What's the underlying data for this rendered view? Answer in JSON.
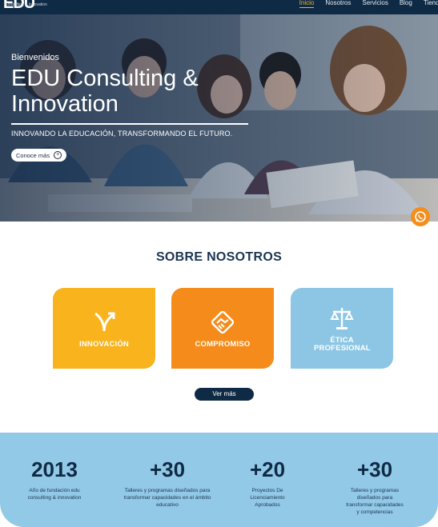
{
  "nav": {
    "logo_mark": "EDU",
    "logo_sub": "Consulting & Innovation",
    "links": [
      "Inicio",
      "Nosotros",
      "Servicios",
      "Blog",
      "Tienda"
    ]
  },
  "hero": {
    "welcome": "Bienvenidos",
    "title": "EDU Consulting & Innovation",
    "tagline": "INNOVANDO LA EDUCACIÓN, TRANSFORMANDO EL FUTURO.",
    "cta_label": "Conoce más"
  },
  "about": {
    "title": "SOBRE NOSOTROS",
    "cards": [
      {
        "label": "INNOVACIÓN",
        "icon": "merge-arrow-icon",
        "color": "#f8b31d"
      },
      {
        "label": "COMPROMISO",
        "icon": "handshake-icon",
        "color": "#f58b1a"
      },
      {
        "label": "ÉTICA PROFESIONAL",
        "icon": "scales-icon",
        "color": "#8cc6e4"
      }
    ],
    "more_label": "Ver más"
  },
  "stats": [
    {
      "value": "2013",
      "desc": "Año de fundación edu consulting & innovation"
    },
    {
      "value": "+30",
      "desc": "Talleres y programas diseñados para transformar capacidades en el ámbito educativo"
    },
    {
      "value": "+20",
      "desc": "Proyectos De Licenciamiento Aprobados"
    },
    {
      "value": "+30",
      "desc": "Talleres y programas diseñados para transformar capacidades y competencias"
    }
  ],
  "colors": {
    "navy": "#0f2a44",
    "accent_orange": "#f58b1a",
    "accent_yellow": "#f8b31d",
    "light_blue": "#92c9e7"
  }
}
